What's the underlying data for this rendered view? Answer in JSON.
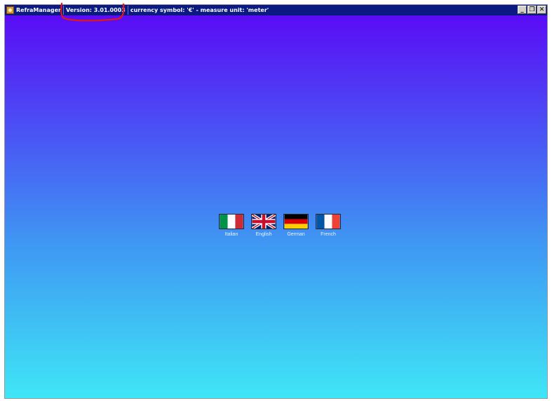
{
  "titlebar": {
    "app_name": "RefraManager",
    "version": "Version: 3.01.0003",
    "info": "currency symbol: '€'  -  measure unit: 'meter'",
    "buttons": {
      "minimize": "_",
      "restore": "❐",
      "close": "✕"
    }
  },
  "languages": [
    {
      "label": "Italian",
      "icon": "italy-flag-icon"
    },
    {
      "label": "English",
      "icon": "uk-flag-icon"
    },
    {
      "label": "German",
      "icon": "germany-flag-icon"
    },
    {
      "label": "French",
      "icon": "france-flag-icon"
    }
  ],
  "colors": {
    "titlebar": "#0a1a82",
    "gradient_top": "#5a0cf5",
    "gradient_bottom": "#3fe6f6",
    "annotation": "#e01818"
  }
}
